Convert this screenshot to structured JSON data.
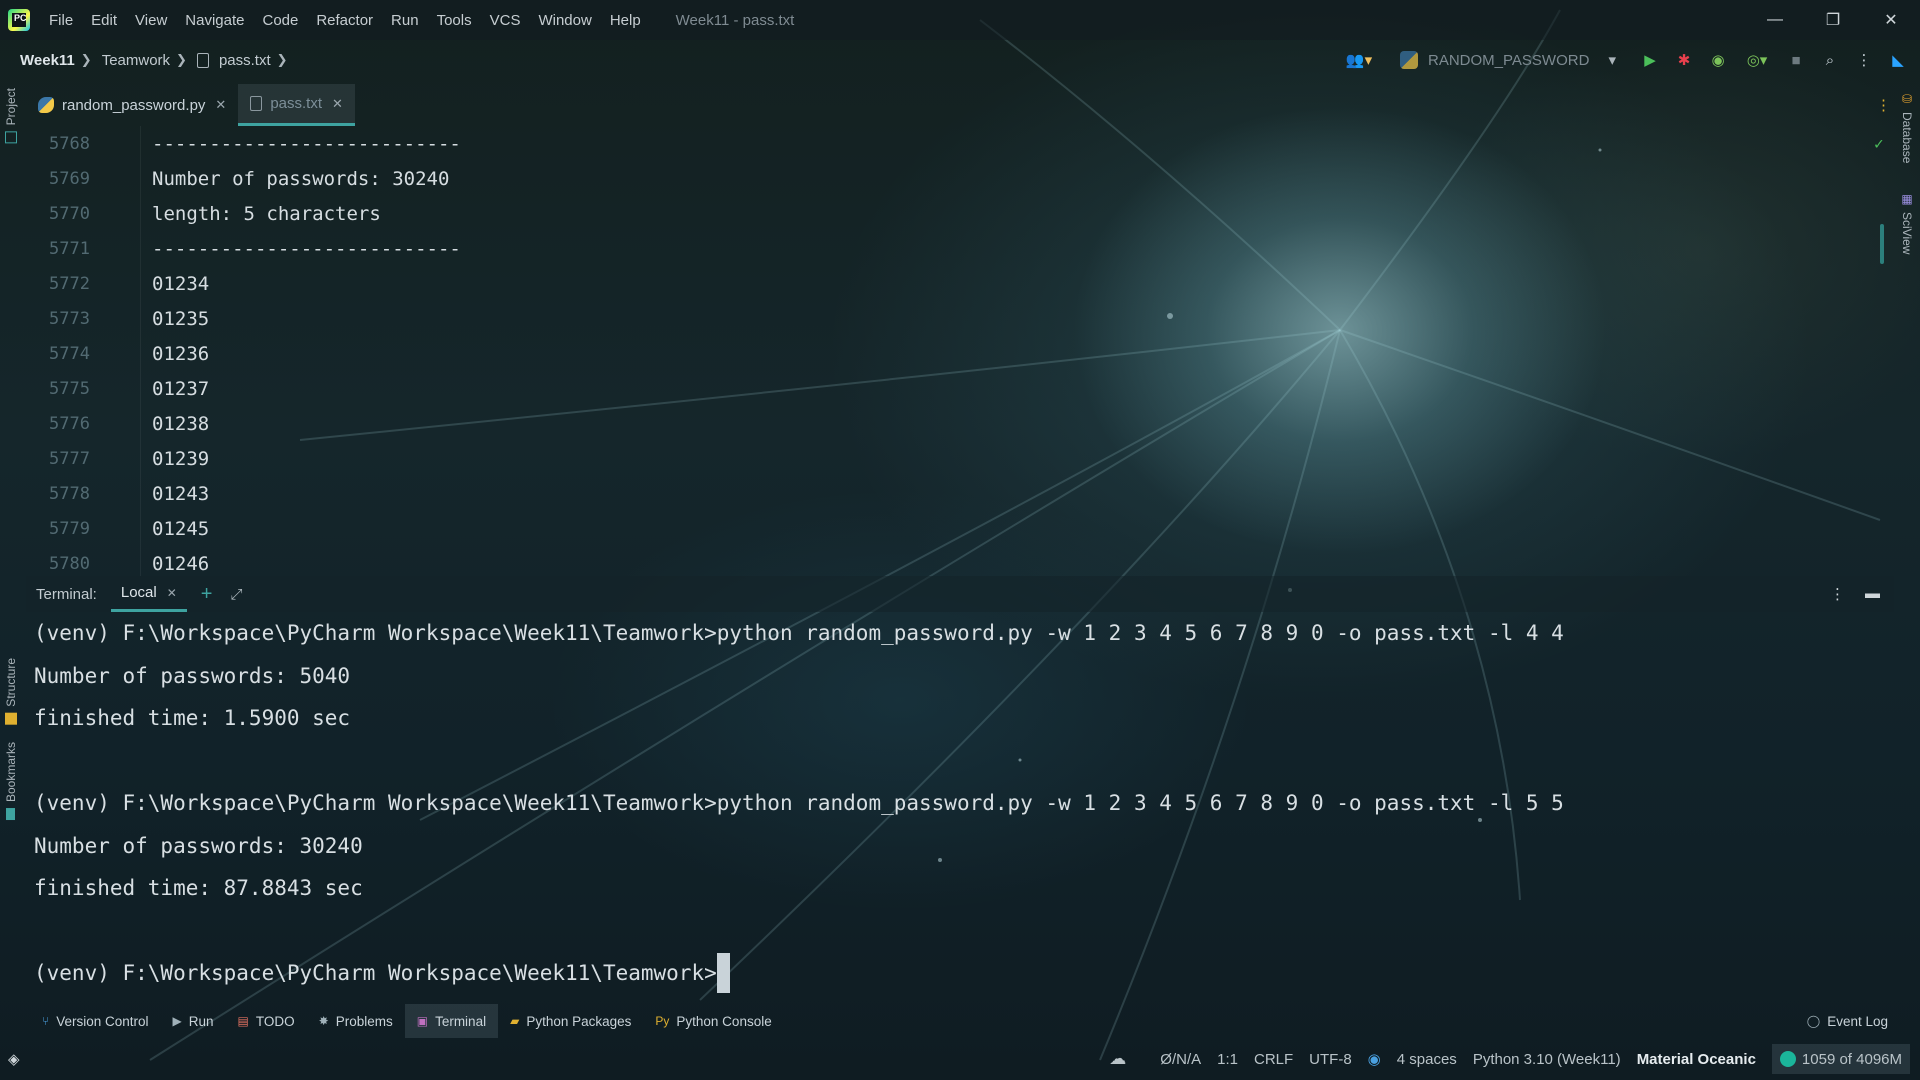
{
  "window": {
    "title": "Week11 - pass.txt",
    "menu": [
      "File",
      "Edit",
      "View",
      "Navigate",
      "Code",
      "Refactor",
      "Run",
      "Tools",
      "VCS",
      "Window",
      "Help"
    ],
    "controls": {
      "minimize": "—",
      "restore": "❐",
      "close": "✕"
    }
  },
  "navbar": {
    "breadcrumb": [
      "Week11",
      "Teamwork",
      "pass.txt"
    ],
    "run_config": "RANDOM_PASSWORD"
  },
  "editor_tabs": [
    {
      "label": "random_password.py",
      "icon": "python-file-icon",
      "active": false
    },
    {
      "label": "pass.txt",
      "icon": "text-file-icon",
      "active": true
    }
  ],
  "editor": {
    "lines": [
      {
        "num": "5768",
        "text": "---------------------------"
      },
      {
        "num": "5769",
        "text": "Number of passwords: 30240"
      },
      {
        "num": "5770",
        "text": "length: 5 characters"
      },
      {
        "num": "5771",
        "text": "---------------------------"
      },
      {
        "num": "5772",
        "text": "01234"
      },
      {
        "num": "5773",
        "text": "01235"
      },
      {
        "num": "5774",
        "text": "01236"
      },
      {
        "num": "5775",
        "text": "01237"
      },
      {
        "num": "5776",
        "text": "01238"
      },
      {
        "num": "5777",
        "text": "01239"
      },
      {
        "num": "5778",
        "text": "01243"
      },
      {
        "num": "5779",
        "text": "01245"
      },
      {
        "num": "5780",
        "text": "01246"
      }
    ]
  },
  "terminal": {
    "label": "Terminal:",
    "tab": "Local",
    "lines": [
      "(venv) F:\\Workspace\\PyCharm Workspace\\Week11\\Teamwork>python random_password.py -w 1 2 3 4 5 6 7 8 9 0 -o pass.txt -l 4 4",
      "Number of passwords: 5040",
      "finished time: 1.5900 sec",
      "",
      "(venv) F:\\Workspace\\PyCharm Workspace\\Week11\\Teamwork>python random_password.py -w 1 2 3 4 5 6 7 8 9 0 -o pass.txt -l 5 5",
      "Number of passwords: 30240",
      "finished time: 87.8843 sec",
      ""
    ],
    "prompt": "(venv) F:\\Workspace\\PyCharm Workspace\\Week11\\Teamwork>"
  },
  "left_tools": [
    "Project",
    "Structure",
    "Bookmarks"
  ],
  "right_tools": [
    "Database",
    "SciView"
  ],
  "tool_windows": [
    {
      "label": "Version Control",
      "icon": "branch-icon"
    },
    {
      "label": "Run",
      "icon": "play-icon"
    },
    {
      "label": "TODO",
      "icon": "todo-icon"
    },
    {
      "label": "Problems",
      "icon": "bug-icon"
    },
    {
      "label": "Terminal",
      "icon": "terminal-icon",
      "active": true
    },
    {
      "label": "Python Packages",
      "icon": "packages-icon"
    },
    {
      "label": "Python Console",
      "icon": "python-console-icon"
    }
  ],
  "event_log": "Event Log",
  "status": {
    "na": "Ø/N/A",
    "position": "1:1",
    "line_sep": "CRLF",
    "encoding": "UTF-8",
    "indent": "4 spaces",
    "interpreter": "Python 3.10 (Week11)",
    "theme": "Material Oceanic",
    "memory": "1059 of 4096M"
  },
  "colors": {
    "accent": "#3ea3a0",
    "run": "#4bbf5a",
    "debug": "#e8404d"
  }
}
